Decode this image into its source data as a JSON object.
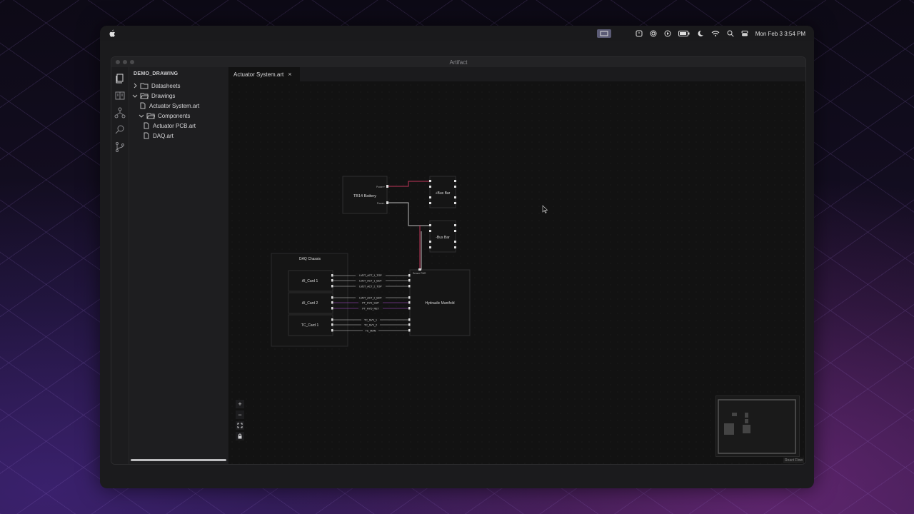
{
  "menubar": {
    "datetime": "Mon Feb 3  3:54 PM",
    "icons": [
      "apple-icon",
      "display-icon",
      "timer-icon",
      "wheel-icon",
      "play-icon",
      "battery-icon",
      "moon-icon",
      "wifi-icon",
      "search-icon",
      "control-center-icon"
    ]
  },
  "window": {
    "title": "Artifact"
  },
  "sidebar": {
    "title": "DEMO_DRAWING",
    "items": [
      {
        "label": "Datasheets",
        "type": "folder",
        "expanded": false
      },
      {
        "label": "Drawings",
        "type": "folder",
        "expanded": true
      },
      {
        "label": "Actuator System.art",
        "type": "file"
      },
      {
        "label": "Components",
        "type": "folder",
        "expanded": true
      },
      {
        "label": "Actuator PCB.art",
        "type": "file"
      },
      {
        "label": "DAQ.art",
        "type": "file"
      }
    ]
  },
  "activity_icons": [
    "files-icon",
    "book-icon",
    "hierarchy-icon",
    "search-icon",
    "source-control-icon"
  ],
  "editor": {
    "tab": {
      "label": "Actuator System.art",
      "close": "×"
    }
  },
  "diagram": {
    "battery": {
      "label": "TB14 Battery",
      "ports": [
        "Power+",
        "Power-"
      ]
    },
    "pos_bus": {
      "label": "+Bus Bar"
    },
    "neg_bus": {
      "label": "-Bus Bar"
    },
    "daq": {
      "label": "DAQ Chassis"
    },
    "cards": [
      {
        "label": "AI_Card 1",
        "signals": [
          "LVDT_ACT_1_TOP",
          "LVDT_ACT_1_BOT",
          "LVDT_ACT_2_TOP"
        ]
      },
      {
        "label": "AI_Card 2",
        "signals": [
          "LVDT_ACT_2_BOT",
          "PT_HYD_SUP",
          "PT_HYD_RET"
        ]
      },
      {
        "label": "TC_Card 1",
        "signals": [
          "TC_SVV_1",
          "TC_SVV_2",
          "TC_MAN"
        ]
      }
    ],
    "manifold": {
      "label": "Hydraulic Manifold",
      "port": "Sensor PWR"
    },
    "colors": {
      "power": "#c0355a",
      "signal": "#d8d8d8",
      "hyd": "#b14fd8",
      "border": "#3a3a3c"
    }
  },
  "controls": [
    {
      "name": "zoom-in-button",
      "glyph": "+"
    },
    {
      "name": "zoom-out-button",
      "glyph": "−"
    },
    {
      "name": "fit-view-button",
      "glyph": "⛶"
    },
    {
      "name": "lock-button",
      "glyph": "🔒"
    }
  ],
  "attribution": "React Flow"
}
